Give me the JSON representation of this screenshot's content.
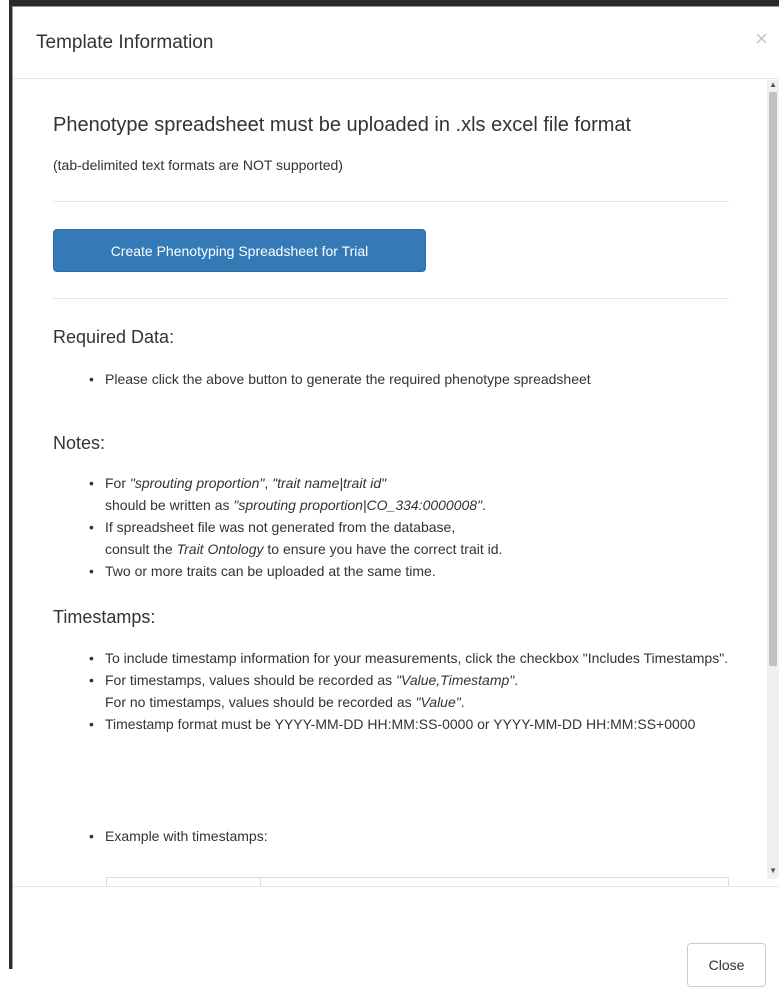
{
  "modal": {
    "title": "Template Information",
    "close_x": "×",
    "heading": "Phenotype spreadsheet must be uploaded in .xls excel file format",
    "subnote": "(tab-delimited text formats are NOT supported)",
    "create_button": "Create Phenotyping Spreadsheet for Trial",
    "footer_close": "Close"
  },
  "required": {
    "heading": "Required Data:",
    "items": [
      "Please click the above button to generate the required phenotype spreadsheet"
    ]
  },
  "notes": {
    "heading": "Notes:",
    "n1_a": "For ",
    "n1_b": "\"sprouting proportion\"",
    "n1_c": ", ",
    "n1_d": "\"trait name|trait id\"",
    "n1_e": "should be written as ",
    "n1_f": "\"sprouting proportion|CO_334:0000008\"",
    "n1_g": ".",
    "n2_a": "If spreadsheet file was not generated from the database,",
    "n2_b": "consult the ",
    "n2_c": "Trait Ontology",
    "n2_d": " to ensure you have the correct trait id.",
    "n3": "Two or more traits can be uploaded at the same time."
  },
  "timestamps": {
    "heading": "Timestamps:",
    "t1": "To include timestamp information for your measurements, click the checkbox \"Includes Timestamps\".",
    "t2_a": "For timestamps, values should be recorded as ",
    "t2_b": "\"Value,Timestamp\"",
    "t2_c": ".",
    "t2_d": "For no timestamps, values should be recorded as ",
    "t2_e": "\"Value\"",
    "t2_f": ".",
    "t3": "Timestamp format must be YYYY-MM-DD HH:MM:SS-0000 or YYYY-MM-DD HH:MM:SS+0000",
    "t4": "Example with timestamps:"
  },
  "scrollbar": {
    "up": "▲",
    "down": "▼"
  }
}
